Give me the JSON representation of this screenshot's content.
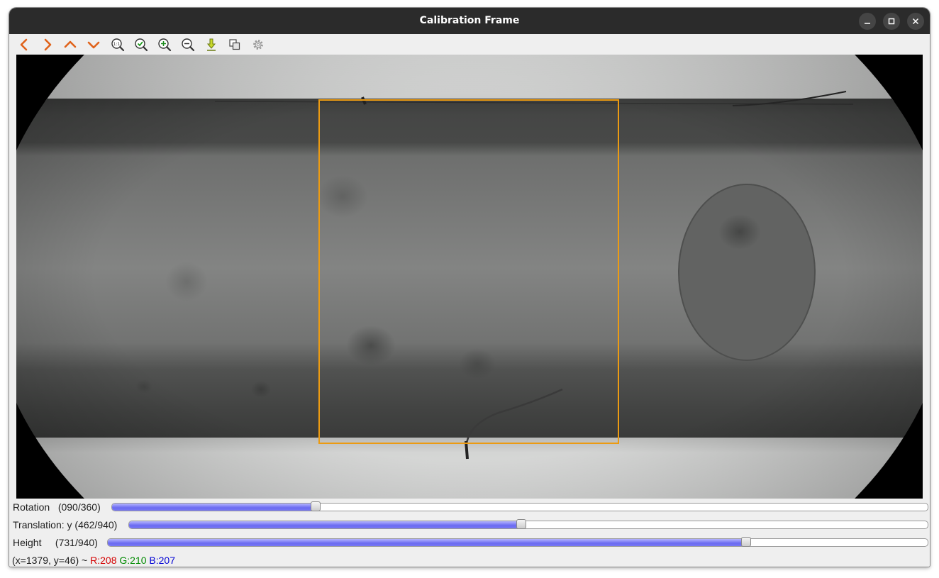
{
  "window": {
    "title": "Calibration Frame",
    "controls": {
      "minimize": "minimize-icon",
      "maximize": "maximize-icon",
      "close": "close-icon"
    }
  },
  "toolbar": {
    "buttons": [
      {
        "icon": "arrow-left-icon",
        "label": "Previous"
      },
      {
        "icon": "arrow-right-icon",
        "label": "Next"
      },
      {
        "icon": "arrow-up-icon",
        "label": "Up"
      },
      {
        "icon": "arrow-down-icon",
        "label": "Down"
      },
      {
        "icon": "zoom-original-icon",
        "label": "Zoom 1:1"
      },
      {
        "icon": "zoom-fit-icon",
        "label": "Zoom fit"
      },
      {
        "icon": "zoom-in-icon",
        "label": "Zoom in"
      },
      {
        "icon": "zoom-out-icon",
        "label": "Zoom out"
      },
      {
        "icon": "save-icon",
        "label": "Save"
      },
      {
        "icon": "copy-icon",
        "label": "Copy"
      },
      {
        "icon": "settings-icon",
        "label": "Properties"
      }
    ]
  },
  "sliders": [
    {
      "label": "Rotation   (090/360)",
      "value": 90,
      "max": 360
    },
    {
      "label": "Translation: y (462/940)",
      "value": 462,
      "max": 940
    },
    {
      "label": "Height     (731/940)",
      "value": 731,
      "max": 940
    }
  ],
  "status": {
    "coords": "(x=1379, y=46) ~ ",
    "r": "R:208",
    "g": "G:210",
    "b": "B:207"
  },
  "colors": {
    "roi": "#ec9b12",
    "r": "#d40000",
    "g": "#008a00",
    "b": "#0000d4"
  }
}
